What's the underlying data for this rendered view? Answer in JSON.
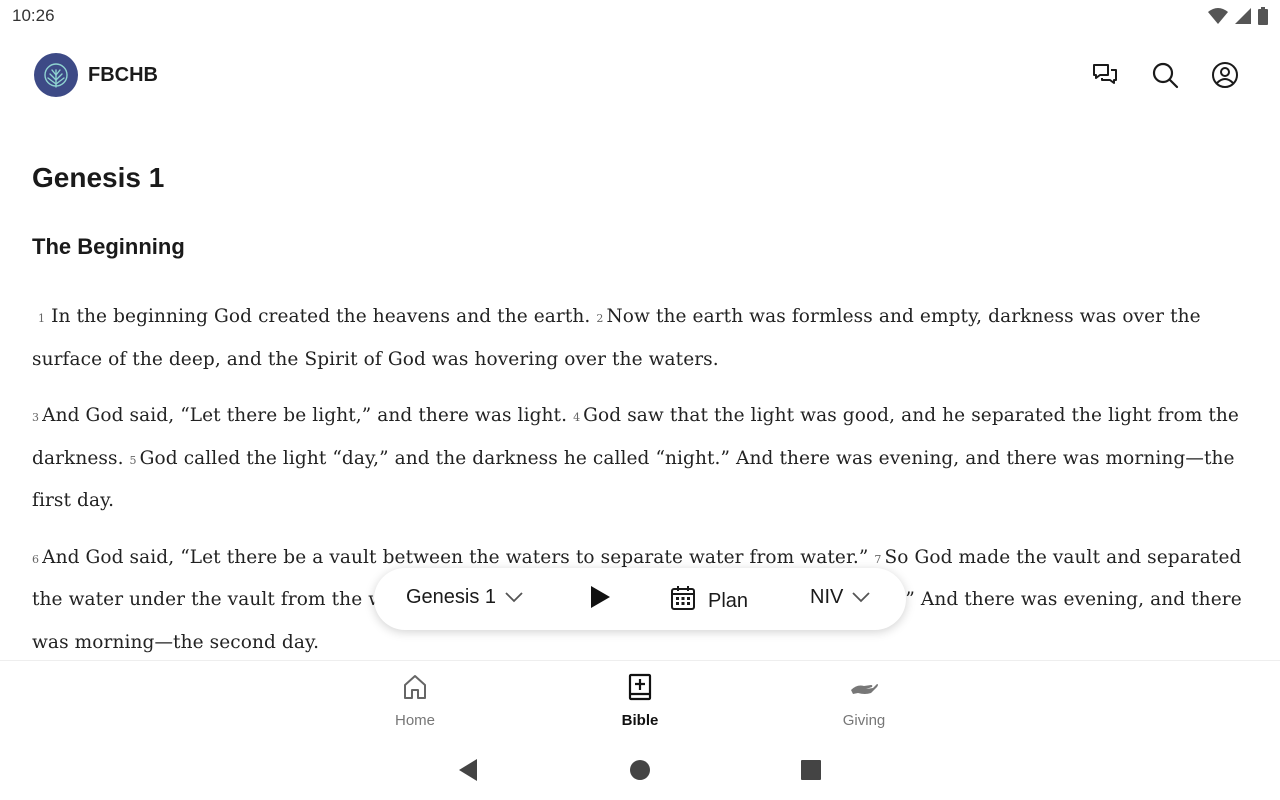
{
  "status_bar": {
    "time": "10:26",
    "icons": [
      "wifi-icon",
      "cellular-signal-icon",
      "battery-icon"
    ]
  },
  "header": {
    "app_name": "FBCHB",
    "logo_icon": "tree-logo-icon",
    "actions": [
      "chat-icon",
      "search-icon",
      "account-icon"
    ]
  },
  "reader": {
    "chapter_title": "Genesis 1",
    "section_heading": "The Beginning",
    "paragraphs": [
      {
        "verses": [
          {
            "num": "1",
            "text": "In the beginning God created the heavens and the earth."
          },
          {
            "num": "2",
            "text": "Now the earth was formless and empty, darkness was over the surface of the deep, and the Spirit of God was hovering over the waters."
          }
        ]
      },
      {
        "verses": [
          {
            "num": "3",
            "text": "And God said, “Let there be light,” and there was light."
          },
          {
            "num": "4",
            "text": "God saw that the light was good, and he separated the light from the darkness."
          },
          {
            "num": "5",
            "text": "God called the light “day,” and the darkness he called “night.” And there was evening, and there was morning—the first day."
          }
        ]
      },
      {
        "verses": [
          {
            "num": "6",
            "text": "And God said, “Let there be a vault between the waters to separate water from water.”"
          },
          {
            "num": "7",
            "text": "So God made the vault and separated the water under the vault from the water above it. And it was so."
          },
          {
            "num": "8",
            "text": "God called the vault “sky.” And there was evening, and there was morning—the second day."
          }
        ]
      }
    ]
  },
  "player": {
    "chapter_label": "Genesis 1",
    "plan_label": "Plan",
    "version_label": "NIV"
  },
  "bottom_nav": {
    "items": [
      {
        "label": "Home",
        "icon": "home-icon",
        "active": false
      },
      {
        "label": "Bible",
        "icon": "bible-icon",
        "active": true
      },
      {
        "label": "Giving",
        "icon": "giving-hand-icon",
        "active": false
      }
    ]
  },
  "system_nav": [
    "back-icon",
    "home-circle-icon",
    "recents-square-icon"
  ],
  "colors": {
    "logo_bg": "#3d4a86",
    "text_primary": "#1a1a1a",
    "nav_inactive": "#777777"
  }
}
